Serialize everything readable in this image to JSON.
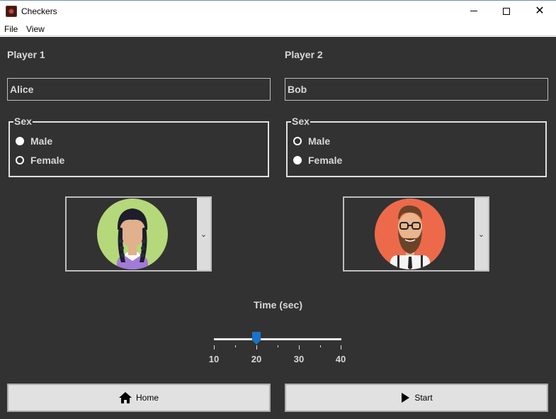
{
  "window": {
    "title": "Checkers"
  },
  "menu": {
    "file": "File",
    "view": "View"
  },
  "player1": {
    "label": "Player 1",
    "name": "Alice",
    "sex_legend": "Sex",
    "options": [
      "Male",
      "Female"
    ],
    "selected": "Male",
    "avatar": "woman-avatar-icon"
  },
  "player2": {
    "label": "Player 2",
    "name": "Bob",
    "sex_legend": "Sex",
    "options": [
      "Male",
      "Female"
    ],
    "selected": "Female",
    "avatar": "bearded-man-avatar-icon"
  },
  "time": {
    "label": "Time (sec)",
    "min": 10,
    "max": 40,
    "value": 20,
    "ticks": [
      "10",
      "20",
      "30",
      "40"
    ]
  },
  "buttons": {
    "home": "Home",
    "start": "Start"
  },
  "colors": {
    "background": "#323232",
    "accent": "#1a73c8",
    "text": "#d8d8d8"
  }
}
